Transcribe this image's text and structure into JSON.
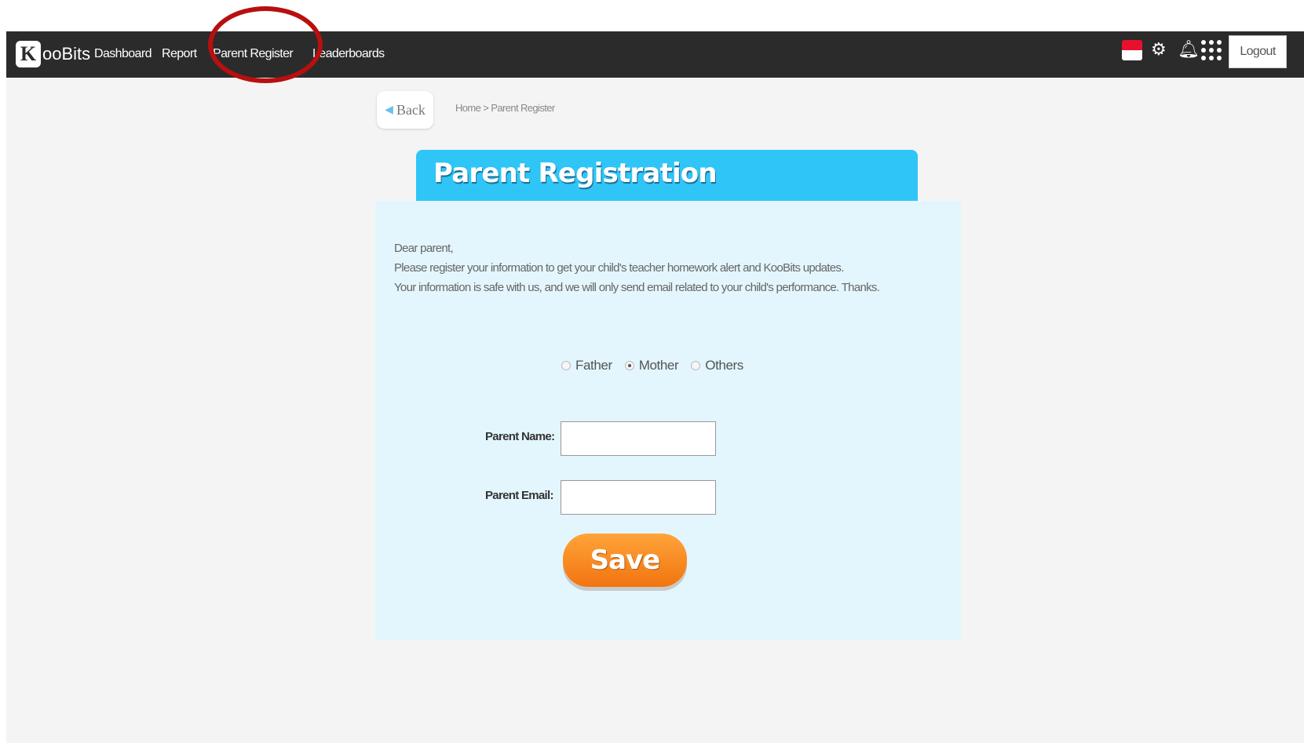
{
  "brand": {
    "logo_letter": "K",
    "logo_rest": "ooBits"
  },
  "nav": {
    "dashboard": "Dashboard",
    "report": "Report",
    "parent_register": "Parent Register",
    "leaderboards": "Leaderboards"
  },
  "topbar": {
    "flag": "singapore-flag-icon",
    "icons": [
      "gear-icon",
      "bell-icon",
      "apps-grid-icon"
    ],
    "logout": "Logout"
  },
  "back_label": "Back",
  "breadcrumb": "Home > Parent Register",
  "title": "Parent Registration",
  "intro": {
    "line1": "Dear parent,",
    "line2": "Please register your information to get your child's teacher homework alert and KooBits updates.",
    "line3": "Your information is safe with us, and we will only send email related to your child's performance. Thanks."
  },
  "relation": {
    "options": [
      "Father",
      "Mother",
      "Others"
    ],
    "selected": "Mother"
  },
  "form": {
    "name_label": "Parent Name:",
    "name_value": "",
    "email_label": "Parent Email:",
    "email_value": ""
  },
  "save_label": "Save",
  "colors": {
    "topbar": "#2b2b2b",
    "title_bar": "#2fc5f7",
    "card": "#e3f6fd",
    "save_button": "#f58a1f",
    "highlight_ring": "#b80f0f"
  }
}
